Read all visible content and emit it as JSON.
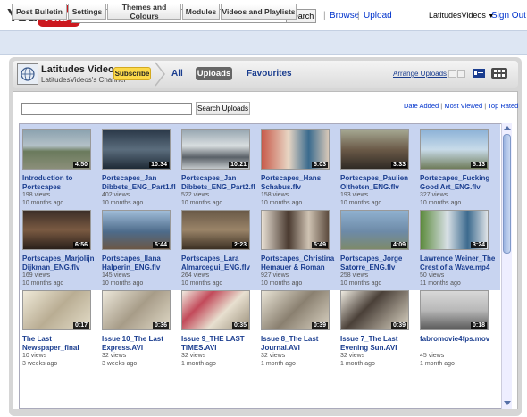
{
  "header": {
    "logo": {
      "you": "You",
      "tube": "Tube"
    },
    "search_button": "Search",
    "nav": {
      "browse": "Browse",
      "upload": "Upload",
      "separator": "|"
    },
    "account": {
      "username": "LatitudesVideos",
      "sign_out": "Sign Out"
    }
  },
  "edit_bar": {
    "buttons": [
      "Post Bulletin",
      "Settings",
      "Themes and Colours",
      "Modules",
      "Videos and Playlists"
    ]
  },
  "channel": {
    "name": "Latitudes Videos",
    "subtitle": "LatitudesVideos's Channel",
    "subscribe": "Subscribe",
    "tabs": {
      "all": "All",
      "uploads": "Uploads",
      "favourites": "Favourites"
    },
    "arrange": "Arrange Uploads"
  },
  "uploads": {
    "search_button": "Search Uploads",
    "sort": {
      "date_added": "Date Added",
      "most_viewed": "Most Viewed",
      "top_rated": "Top Rated",
      "separator": "|"
    },
    "videos": [
      {
        "title_1": "Introduction to",
        "title_2": "Portscapes",
        "duration": "4:50",
        "views": "198 views",
        "age": "10 months ago",
        "selected": true
      },
      {
        "title_1": "Portscapes_Jan",
        "title_2": "Dibbets_ENG_Part1.fl",
        "duration": "10:34",
        "views": "402 views",
        "age": "10 months ago",
        "selected": true
      },
      {
        "title_1": "Portscapes_Jan",
        "title_2": "Dibbets_ENG_Part2.fl",
        "duration": "10:21",
        "views": "522 views",
        "age": "10 months ago",
        "selected": true
      },
      {
        "title_1": "Portscapes_Hans",
        "title_2": "Schabus.flv",
        "duration": "5:03",
        "views": "158 views",
        "age": "10 months ago",
        "selected": true
      },
      {
        "title_1": "Portscapes_Paulien",
        "title_2": "Oltheten_ENG.flv",
        "duration": "3:33",
        "views": "193 views",
        "age": "10 months ago",
        "selected": true
      },
      {
        "title_1": "Portscapes_Fucking",
        "title_2": "Good Art_ENG.flv",
        "duration": "5:13",
        "views": "327 views",
        "age": "10 months ago",
        "selected": true
      },
      {
        "title_1": "Portscapes_Marjolijn",
        "title_2": "Dijkman_ENG.flv",
        "duration": "6:56",
        "views": "169 views",
        "age": "10 months ago",
        "selected": true
      },
      {
        "title_1": "Portscapes_Ilana",
        "title_2": "Halperin_ENG.flv",
        "duration": "5:44",
        "views": "145 views",
        "age": "10 months ago",
        "selected": true
      },
      {
        "title_1": "Portscapes_Lara",
        "title_2": "Almarcegui_ENG.flv",
        "duration": "2:23",
        "views": "264 views",
        "age": "10 months ago",
        "selected": true
      },
      {
        "title_1": "Portscapes_Christina",
        "title_2": "Hemauer & Roman",
        "duration": "5:49",
        "views": "927 views",
        "age": "10 months ago",
        "selected": true
      },
      {
        "title_1": "Portscapes_Jorge",
        "title_2": "Satorre_ENG.flv",
        "duration": "4:09",
        "views": "258 views",
        "age": "10 months ago",
        "selected": true
      },
      {
        "title_1": "Lawrence Weiner_The",
        "title_2": "Crest of a Wave.mp4",
        "duration": "3:24",
        "views": "50 views",
        "age": "11 months ago",
        "selected": true
      },
      {
        "title_1": "The Last",
        "title_2": "Newspaper_final",
        "duration": "0:17",
        "views": "10 views",
        "age": "3 weeks ago",
        "selected": false
      },
      {
        "title_1": "Issue 10_The Last",
        "title_2": "Express.AVI",
        "duration": "0:36",
        "views": "32 views",
        "age": "3 weeks ago",
        "selected": false
      },
      {
        "title_1": "Issue 9_THE LAST",
        "title_2": "TIMES.AVI",
        "duration": "0:35",
        "views": "32 views",
        "age": "1 month ago",
        "selected": false
      },
      {
        "title_1": "Issue 8_The Last",
        "title_2": "Journal.AVI",
        "duration": "0:39",
        "views": "32 views",
        "age": "1 month ago",
        "selected": false
      },
      {
        "title_1": "Issue 7_The Last",
        "title_2": "Evening Sun.AVI",
        "duration": "0:39",
        "views": "32 views",
        "age": "1 month ago",
        "selected": false
      },
      {
        "title_1": "fabromovie4fps.mov",
        "title_2": "",
        "duration": "0:18",
        "views": "45 views",
        "age": "1 month ago",
        "selected": false
      }
    ]
  },
  "colors": {
    "accent_blue": "#1a3d8f",
    "selection": "#c8d4f0",
    "subscribe_yellow": "#fcd94a",
    "logo_red": "#cc181e"
  }
}
